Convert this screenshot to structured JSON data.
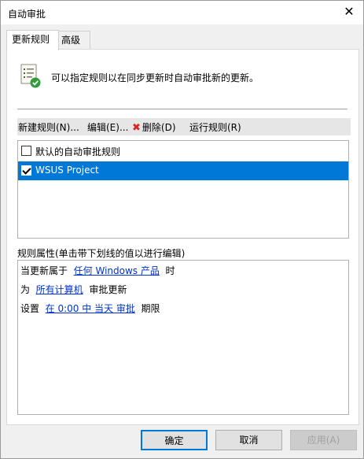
{
  "window": {
    "title": "自动审批"
  },
  "tabs": [
    {
      "label": "更新规则",
      "active": true
    },
    {
      "label": "高级",
      "active": false
    }
  ],
  "info": {
    "icon": "rules-document-check-icon",
    "text": "可以指定规则以在同步更新时自动审批新的更新。"
  },
  "toolbar": {
    "new": "新建规则(N)...",
    "edit": "编辑(E)...",
    "delete": "删除(D)",
    "run": "运行规则(R)"
  },
  "rules": [
    {
      "label": "默认的自动审批规则",
      "checked": false,
      "selected": false
    },
    {
      "label": "WSUS Project",
      "checked": true,
      "selected": true
    }
  ],
  "properties": {
    "heading": "规则属性(单击带下划线的值以进行编辑)",
    "line1": {
      "prefix": "当更新属于",
      "link": "任何 Windows 产品",
      "suffix": "时"
    },
    "line2": {
      "prefix": "为",
      "link": "所有计算机",
      "suffix": "审批更新"
    },
    "line3": {
      "prefix": "设置",
      "link": "在 0:00 中 当天 审批",
      "suffix": "期限"
    }
  },
  "buttons": {
    "ok": "确定",
    "cancel": "取消",
    "apply": "应用(A)"
  },
  "colors": {
    "selection": "#0078d7",
    "link": "#0033cc",
    "delete_icon": "#dd2222"
  }
}
